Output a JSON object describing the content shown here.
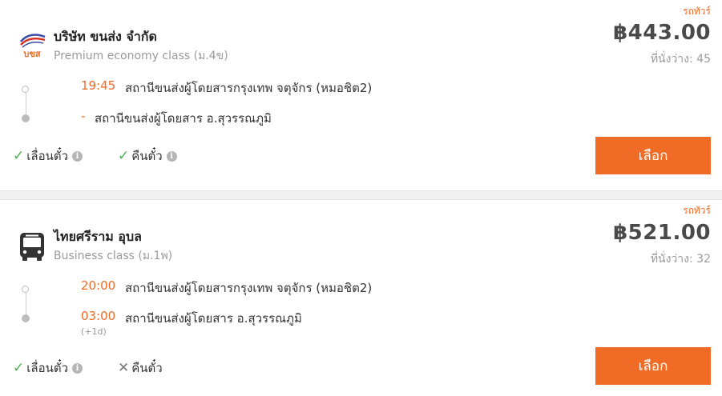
{
  "colors": {
    "accent": "#f06b26",
    "check": "#4caf50",
    "muted": "#9a9a9a"
  },
  "results": [
    {
      "tag": "รถทัวร์",
      "operator": "บริษัท ขนส่ง จำกัด",
      "logo_text": "บขส",
      "class": "Premium economy class (ม.4ข)",
      "price": "฿443.00",
      "seats": "ที่นั่งว่าง: 45",
      "depart_time": "19:45",
      "depart_station": "สถานีขนส่งผู้โดยสารกรุงเทพ จตุจักร (หมอชิต2)",
      "arrive_time": "-",
      "arrive_station": "สถานีขนส่งผู้โดยสาร อ.สุวรรณภูมิ",
      "feature_1": "เลื่อนตั๋ว",
      "feature_2": "คืนตั๋ว",
      "button": "เลือก"
    },
    {
      "tag": "รถทัวร์",
      "operator": "ไทยศรีราม อุบล",
      "class": "Business class (ม.1พ)",
      "price": "฿521.00",
      "seats": "ที่นั่งว่าง: 32",
      "depart_time": "20:00",
      "depart_station": "สถานีขนส่งผู้โดยสารกรุงเทพ จตุจักร (หมอชิต2)",
      "arrive_time": "03:00",
      "arrive_station": "สถานีขนส่งผู้โดยสาร อ.สุวรรณภูมิ",
      "arrive_plus": "(+1d)",
      "feature_1": "เลื่อนตั๋ว",
      "feature_2": "คืนตั๋ว",
      "button": "เลือก"
    }
  ]
}
